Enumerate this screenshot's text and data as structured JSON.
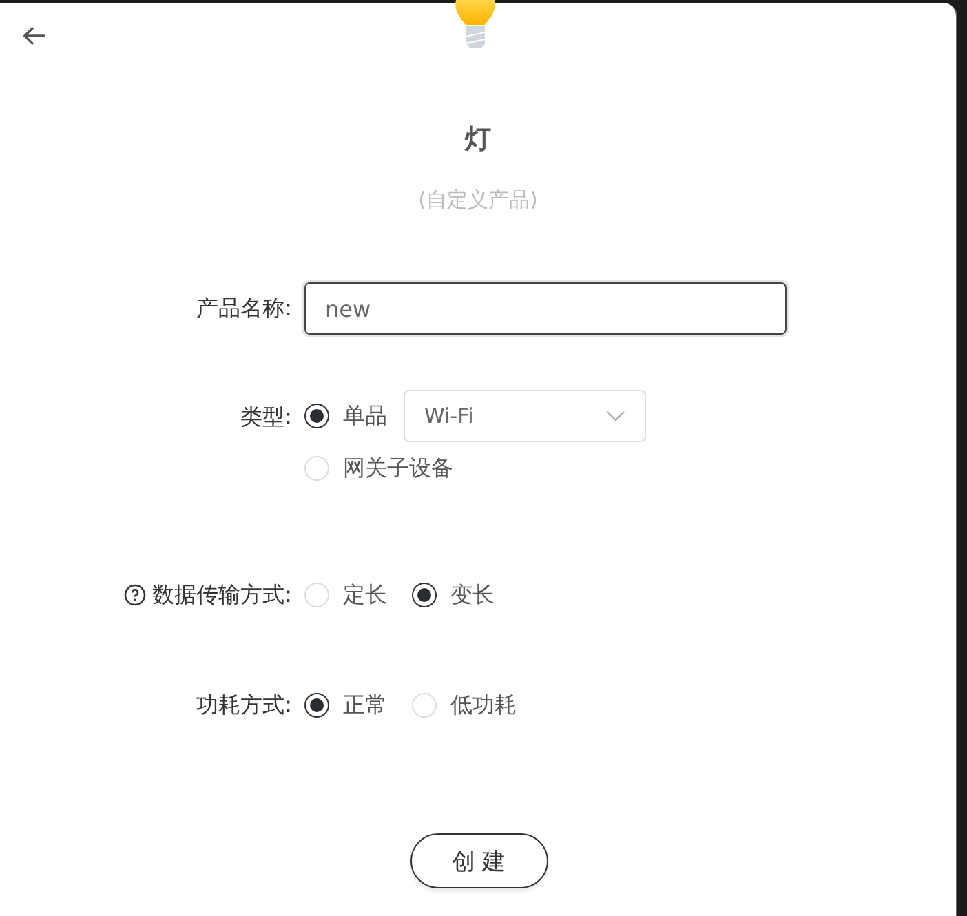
{
  "header": {
    "title": "灯",
    "subtitle": "(自定义产品)"
  },
  "name_field": {
    "label": "产品名称:",
    "value": "new"
  },
  "type_field": {
    "label": "类型:",
    "options": [
      {
        "label": "单品",
        "selected": true,
        "kind": "with-select",
        "select_value": "Wi-Fi"
      },
      {
        "label": "网关子设备",
        "selected": false,
        "kind": "plain"
      }
    ]
  },
  "transfer_field": {
    "label": "数据传输方式:",
    "help": true,
    "options": [
      {
        "label": "定长",
        "selected": false
      },
      {
        "label": "变长",
        "selected": true
      }
    ]
  },
  "power_field": {
    "label": "功耗方式:",
    "options": [
      {
        "label": "正常",
        "selected": true
      },
      {
        "label": "低功耗",
        "selected": false
      }
    ]
  },
  "submit": "创 建"
}
